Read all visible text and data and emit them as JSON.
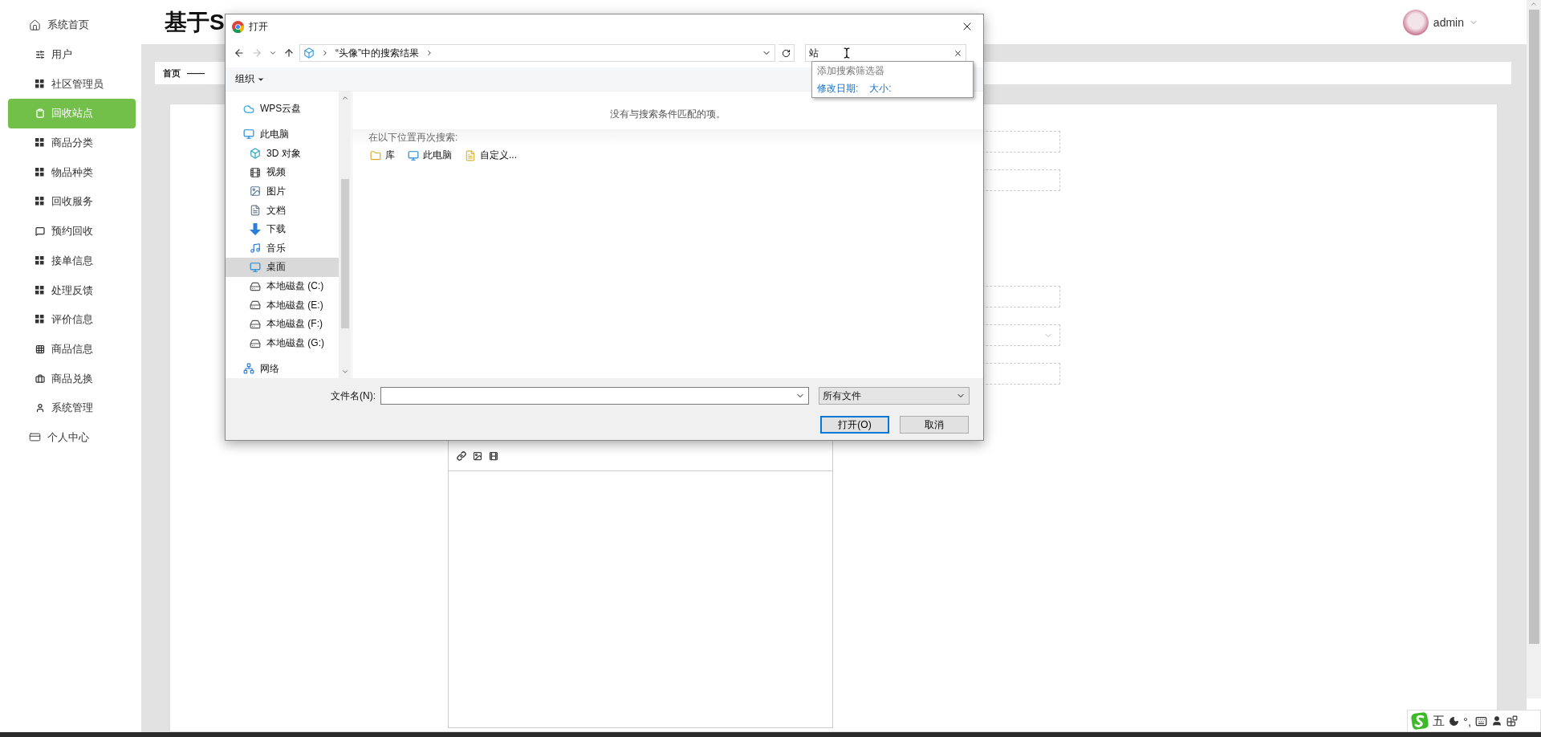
{
  "header": {
    "title": "基于S",
    "user": "admin"
  },
  "sidebar": {
    "items": [
      {
        "label": "系统首页",
        "kind": "section",
        "selected": false
      },
      {
        "label": "用户",
        "kind": "menu",
        "selected": false
      },
      {
        "label": "社区管理员",
        "kind": "menu",
        "selected": false
      },
      {
        "label": "回收站点",
        "kind": "menu",
        "selected": true
      },
      {
        "label": "商品分类",
        "kind": "menu",
        "selected": false
      },
      {
        "label": "物品种类",
        "kind": "menu",
        "selected": false
      },
      {
        "label": "回收服务",
        "kind": "menu",
        "selected": false
      },
      {
        "label": "预约回收",
        "kind": "menu",
        "selected": false
      },
      {
        "label": "接单信息",
        "kind": "menu",
        "selected": false
      },
      {
        "label": "处理反馈",
        "kind": "menu",
        "selected": false
      },
      {
        "label": "评价信息",
        "kind": "menu",
        "selected": false
      },
      {
        "label": "商品信息",
        "kind": "menu",
        "selected": false
      },
      {
        "label": "商品兑换",
        "kind": "menu",
        "selected": false
      },
      {
        "label": "系统管理",
        "kind": "menu",
        "selected": false
      },
      {
        "label": "个人中心",
        "kind": "section",
        "selected": false
      }
    ]
  },
  "breadcrumb": [
    "首页",
    "——"
  ],
  "form": {
    "groups": [
      {
        "fields": [
          {
            "kind": "input"
          },
          {
            "kind": "input"
          }
        ]
      },
      {
        "fields": [
          {
            "kind": "input"
          },
          {
            "kind": "select"
          },
          {
            "kind": "input"
          }
        ]
      }
    ]
  },
  "dialog": {
    "title": "打开",
    "address": "“头像”中的搜索结果",
    "search": {
      "value": "站"
    },
    "suggest": {
      "title": "添加搜索筛选器",
      "filters": [
        "修改日期:",
        "大小:"
      ]
    },
    "organize": "组织",
    "nav": {
      "items": [
        {
          "label": "WPS云盘",
          "selected": false
        },
        {
          "label": "此电脑",
          "selected": false,
          "children": [
            {
              "label": "3D 对象",
              "selected": false
            },
            {
              "label": "视频",
              "selected": false
            },
            {
              "label": "图片",
              "selected": false
            },
            {
              "label": "文档",
              "selected": false
            },
            {
              "label": "下载",
              "selected": false
            },
            {
              "label": "音乐",
              "selected": false
            },
            {
              "label": "桌面",
              "selected": true
            },
            {
              "label": "本地磁盘 (C:)",
              "selected": false
            },
            {
              "label": "本地磁盘 (E:)",
              "selected": false
            },
            {
              "label": "本地磁盘 (F:)",
              "selected": false
            },
            {
              "label": "本地磁盘 (G:)",
              "selected": false
            }
          ]
        },
        {
          "label": "网络",
          "selected": false
        }
      ]
    },
    "empty_message": "没有与搜索条件匹配的项。",
    "search_again": {
      "title": "在以下位置再次搜索:",
      "locations": [
        "库",
        "此电脑",
        "自定义..."
      ]
    },
    "filename": {
      "label": "文件名(N):"
    },
    "filetype": "所有文件",
    "buttons": [
      {
        "label": "打开(O)",
        "kind": "primary"
      },
      {
        "label": "取消",
        "kind": "normal"
      }
    ]
  },
  "ime": {
    "mode": "五",
    "punctuation": "°,"
  }
}
